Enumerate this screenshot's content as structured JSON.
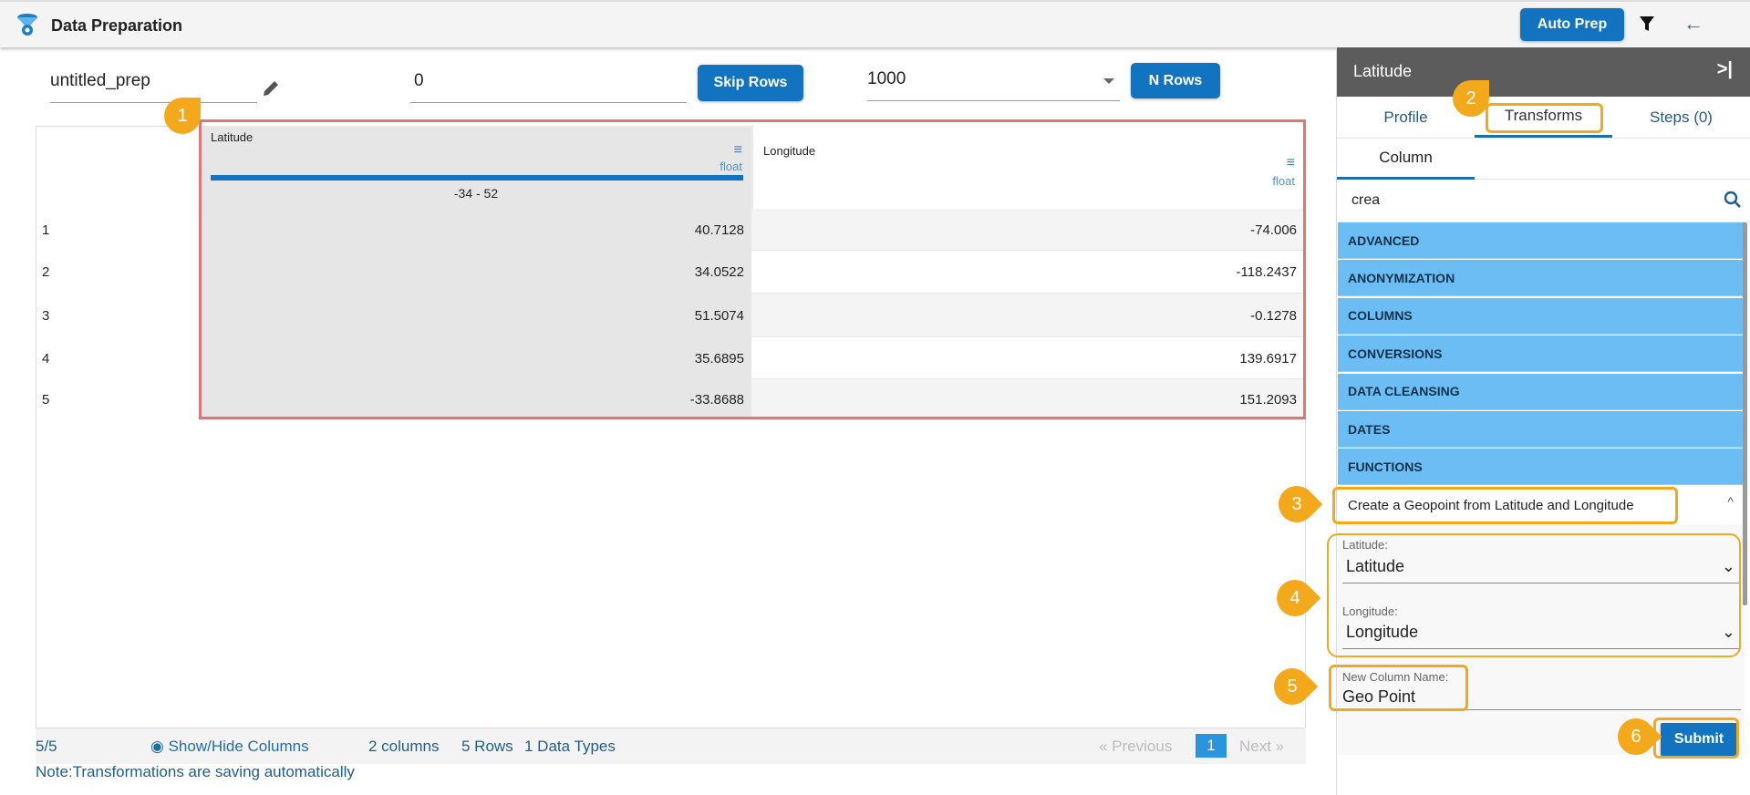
{
  "header": {
    "title": "Data Preparation",
    "auto_prep": "Auto Prep",
    "icons": [
      "data-prep-logo-icon",
      "filter-icon",
      "back-arrow-icon"
    ]
  },
  "toolbar": {
    "prep_name": "untitled_prep",
    "skip_value": "0",
    "skip_rows_label": "Skip Rows",
    "n_rows_value": "1000",
    "n_rows_label": "N Rows"
  },
  "table": {
    "columns": [
      {
        "name": "Latitude",
        "type": "float",
        "range": "-34 - 52"
      },
      {
        "name": "Longitude",
        "type": "float"
      }
    ],
    "rows": [
      {
        "index": "1",
        "lat": "40.7128",
        "lon": "-74.006"
      },
      {
        "index": "2",
        "lat": "34.0522",
        "lon": "-118.2437"
      },
      {
        "index": "3",
        "lat": "51.5074",
        "lon": "-0.1278"
      },
      {
        "index": "4",
        "lat": "35.6895",
        "lon": "139.6917"
      },
      {
        "index": "5",
        "lat": "-33.8688",
        "lon": "151.2093"
      }
    ]
  },
  "footer": {
    "count": "5/5",
    "show_hide": "Show/Hide Columns",
    "columns": "2 columns",
    "rows": "5 Rows",
    "types": "1 Data Types",
    "prev": "« Previous",
    "page": "1",
    "next": "Next »",
    "note": "Note:Transformations are saving automatically"
  },
  "panel": {
    "title": "Latitude",
    "tabs": [
      "Profile",
      "Transforms",
      "Steps (0)"
    ],
    "subtab": "Column",
    "search": "crea",
    "categories": [
      "ADVANCED",
      "ANONYMIZATION",
      "COLUMNS",
      "CONVERSIONS",
      "DATA CLEANSING",
      "DATES",
      "FUNCTIONS"
    ],
    "transform": "Create a Geopoint from Latitude and Longitude",
    "lat_label": "Latitude:",
    "lat_value": "Latitude",
    "lon_label": "Longitude:",
    "lon_value": "Longitude",
    "newcol_label": "New Column Name:",
    "newcol_value": "Geo Point",
    "submit": "Submit"
  },
  "callouts": [
    "1",
    "2",
    "3",
    "4",
    "5",
    "6"
  ],
  "colors": {
    "primary": "#1274c0",
    "category": "#6cbdf4",
    "callout": "#f4a81b",
    "highlight": "#e07070"
  }
}
